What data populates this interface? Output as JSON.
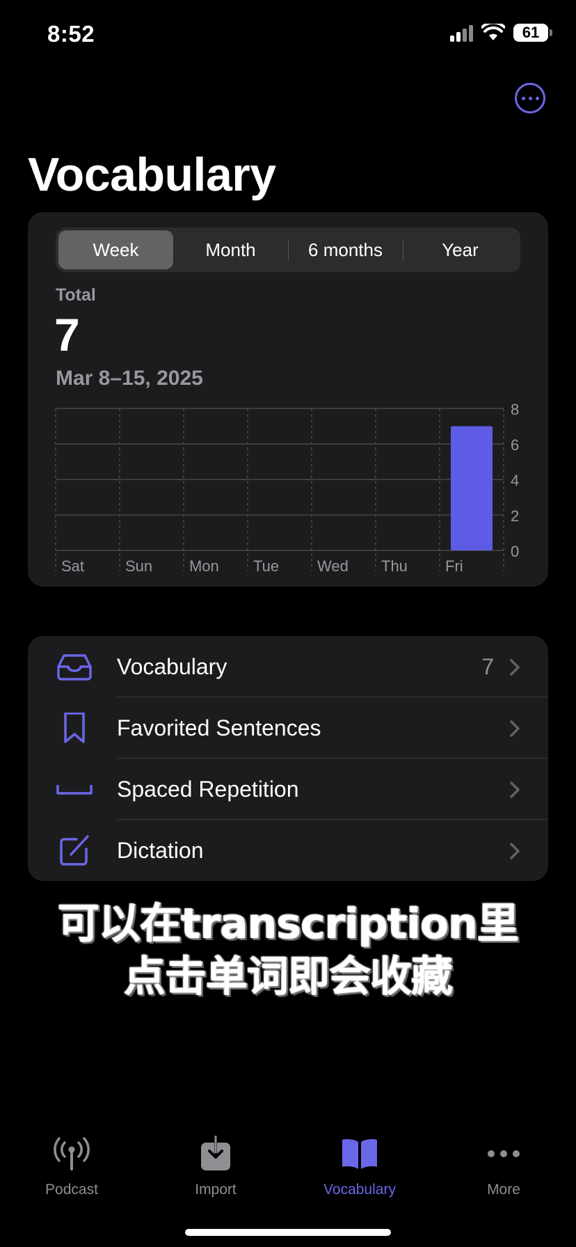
{
  "status_bar": {
    "time": "8:52",
    "battery": "61"
  },
  "header": {
    "title": "Vocabulary",
    "more_icon": "ellipsis-circle-icon"
  },
  "stats": {
    "segments": [
      "Week",
      "Month",
      "6 months",
      "Year"
    ],
    "selected_segment": "Week",
    "total_label": "Total",
    "total_value": "7",
    "date_range": "Mar 8–15, 2025"
  },
  "chart_data": {
    "type": "bar",
    "categories": [
      "Sat",
      "Sun",
      "Mon",
      "Tue",
      "Wed",
      "Thu",
      "Fri"
    ],
    "values": [
      0,
      0,
      0,
      0,
      0,
      0,
      7
    ],
    "ylim": [
      0,
      8
    ],
    "yticks": [
      0,
      2,
      4,
      6,
      8
    ],
    "ytick_labels": [
      "0",
      "2",
      "4",
      "6",
      "8"
    ],
    "grid": true,
    "bar_color": "#5e5ce6"
  },
  "list": {
    "items": [
      {
        "label": "Vocabulary",
        "count": "7",
        "icon": "tray-icon"
      },
      {
        "label": "Favorited Sentences",
        "count": "",
        "icon": "bookmark-icon"
      },
      {
        "label": "Spaced Repetition",
        "count": "",
        "icon": "bracket-icon"
      },
      {
        "label": "Dictation",
        "count": "",
        "icon": "pencil-square-icon"
      }
    ]
  },
  "caption": {
    "line1": "可以在transcription里",
    "line2": "点击单词即会收藏"
  },
  "tab_bar": {
    "items": [
      {
        "label": "Podcast",
        "icon": "antenna-icon"
      },
      {
        "label": "Import",
        "icon": "import-tray-icon"
      },
      {
        "label": "Vocabulary",
        "icon": "book-icon"
      },
      {
        "label": "More",
        "icon": "ellipsis-icon"
      }
    ],
    "active": "Vocabulary"
  },
  "colors": {
    "accent": "#6a67e8",
    "bar": "#5e5ce6",
    "card": "#1c1c1e",
    "background": "#000000"
  }
}
